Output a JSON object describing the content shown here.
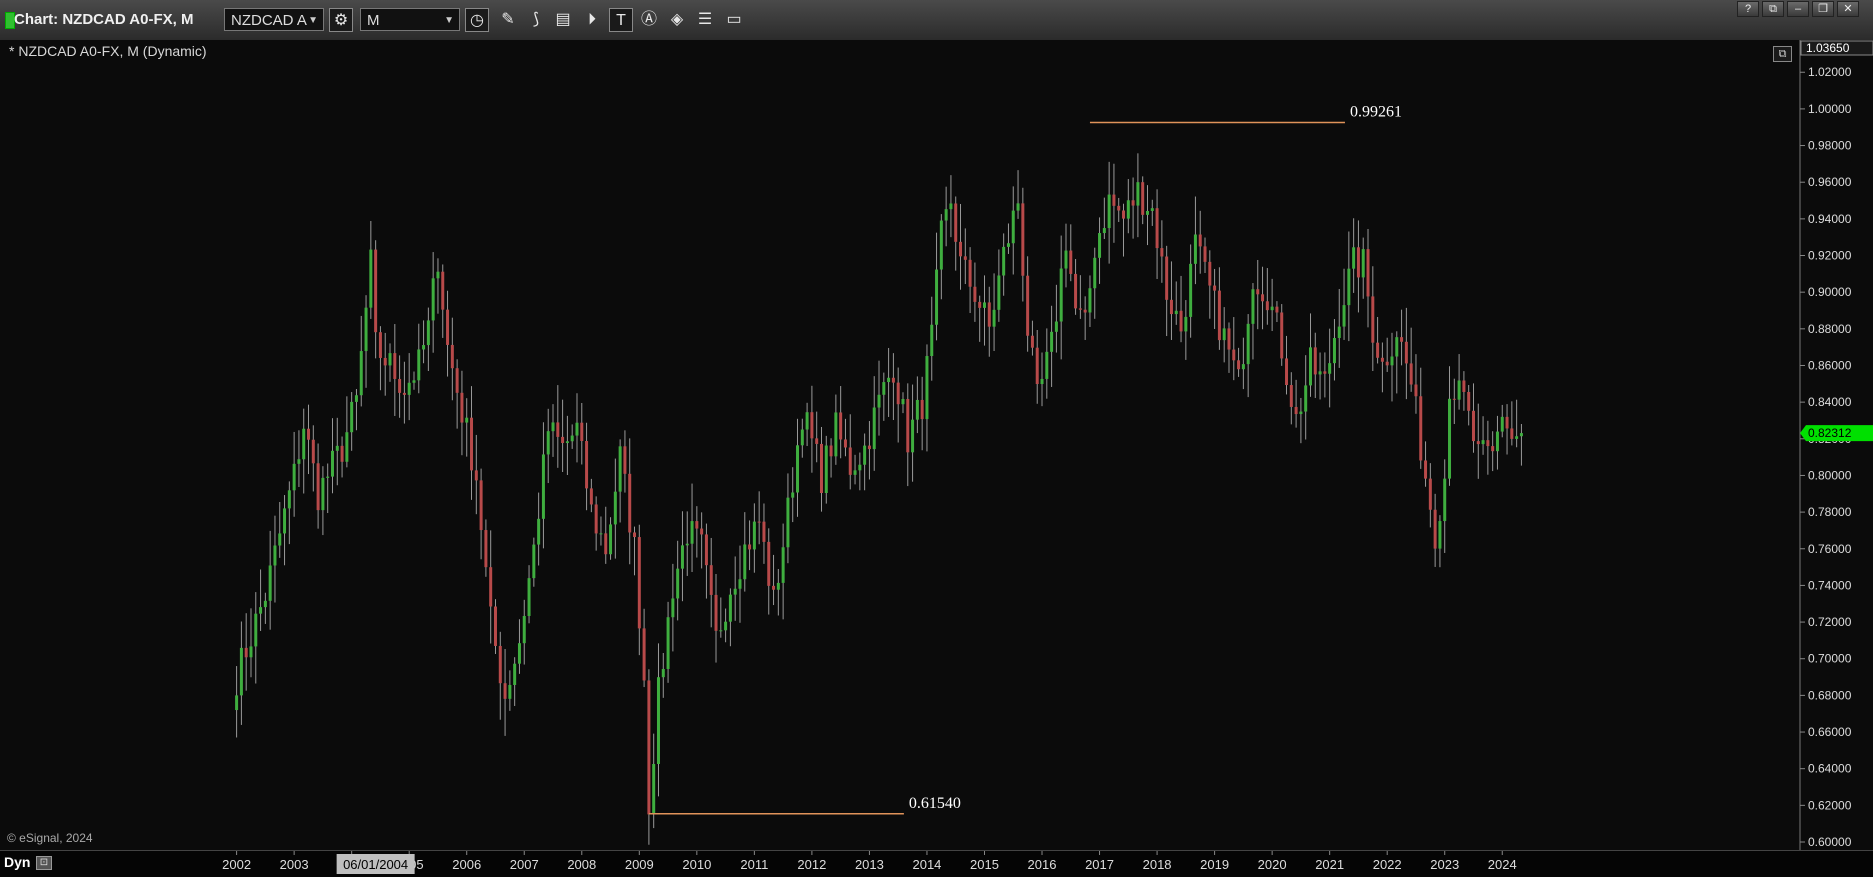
{
  "window": {
    "title": "Chart: NZDCAD A0-FX, M",
    "symbol_combo": "NZDCAD A",
    "interval_combo": "M",
    "winbuttons": [
      "?",
      "⧉",
      "–",
      "❐",
      "✕"
    ]
  },
  "toolbar_icons": [
    "settings-gear-icon",
    "clock-icon",
    "pencil-draw-icon",
    "line-study-icon",
    "bar-chart-icon",
    "play-icon",
    "text-tool-icon",
    "alert-icon",
    "eraser-icon",
    "drawing-menu-icon",
    "comment-icon"
  ],
  "chart_label": "* NZDCAD A0-FX, M (Dynamic)",
  "copyright": "© eSignal, 2024",
  "status": {
    "dyn_label": "Dyn",
    "cursor_date": "06/01/2004"
  },
  "colors": {
    "up": "#3fae3f",
    "down": "#b84a4a",
    "wick": "#9a9a9a",
    "annotation": "#e0935a",
    "last_price_bg": "#00e000"
  },
  "chart_data": {
    "type": "candlestick",
    "title": "",
    "xlabel": "",
    "ylabel": "",
    "ylim": [
      0.6,
      1.0365
    ],
    "y_ticks": [
      "0.60000",
      "0.62000",
      "0.64000",
      "0.66000",
      "0.68000",
      "0.70000",
      "0.72000",
      "0.74000",
      "0.76000",
      "0.78000",
      "0.80000",
      "0.82000",
      "0.84000",
      "0.86000",
      "0.88000",
      "0.90000",
      "0.92000",
      "0.94000",
      "0.96000",
      "0.98000",
      "1.00000",
      "1.02000"
    ],
    "y_top_label": "1.03650",
    "x_ticks": [
      "2002",
      "2003",
      "2004",
      "2005",
      "2006",
      "2007",
      "2008",
      "2009",
      "2010",
      "2011",
      "2012",
      "2013",
      "2014",
      "2015",
      "2016",
      "2017",
      "2018",
      "2019",
      "2020",
      "2021",
      "2022",
      "2023",
      "2024"
    ],
    "last_price": 0.82312,
    "last_price_label": "0.82312",
    "annotations": [
      {
        "label": "0.99261",
        "value": 0.99261,
        "date": "2016-11"
      },
      {
        "label": "0.61540",
        "value": 0.6154,
        "date": "2009-03"
      }
    ],
    "start": "2002-01",
    "end": "2024-05",
    "anchors": [
      [
        "2002-01",
        0.69
      ],
      [
        "2002-07",
        0.735
      ],
      [
        "2003-01",
        0.8
      ],
      [
        "2003-03",
        0.828
      ],
      [
        "2003-06",
        0.79
      ],
      [
        "2003-11",
        0.815
      ],
      [
        "2004-02",
        0.84
      ],
      [
        "2004-05",
        0.915
      ],
      [
        "2004-06",
        0.87
      ],
      [
        "2004-09",
        0.86
      ],
      [
        "2004-12",
        0.848
      ],
      [
        "2005-03",
        0.86
      ],
      [
        "2005-05",
        0.88
      ],
      [
        "2005-07",
        0.92
      ],
      [
        "2005-09",
        0.87
      ],
      [
        "2005-12",
        0.835
      ],
      [
        "2006-03",
        0.8
      ],
      [
        "2006-06",
        0.72
      ],
      [
        "2006-09",
        0.68
      ],
      [
        "2006-12",
        0.71
      ],
      [
        "2007-03",
        0.76
      ],
      [
        "2007-06",
        0.825
      ],
      [
        "2007-09",
        0.815
      ],
      [
        "2007-12",
        0.825
      ],
      [
        "2008-03",
        0.78
      ],
      [
        "2008-06",
        0.76
      ],
      [
        "2008-09",
        0.81
      ],
      [
        "2008-12",
        0.76
      ],
      [
        "2009-02",
        0.69
      ],
      [
        "2009-03",
        0.622
      ],
      [
        "2009-05",
        0.68
      ],
      [
        "2009-08",
        0.74
      ],
      [
        "2009-11",
        0.77
      ],
      [
        "2010-02",
        0.76
      ],
      [
        "2010-05",
        0.71
      ],
      [
        "2010-08",
        0.74
      ],
      [
        "2010-11",
        0.76
      ],
      [
        "2011-02",
        0.775
      ],
      [
        "2011-05",
        0.73
      ],
      [
        "2011-08",
        0.78
      ],
      [
        "2011-11",
        0.835
      ],
      [
        "2012-03",
        0.8
      ],
      [
        "2012-06",
        0.825
      ],
      [
        "2012-09",
        0.805
      ],
      [
        "2012-12",
        0.815
      ],
      [
        "2013-03",
        0.84
      ],
      [
        "2013-06",
        0.86
      ],
      [
        "2013-09",
        0.82
      ],
      [
        "2013-12",
        0.84
      ],
      [
        "2014-02",
        0.875
      ],
      [
        "2014-04",
        0.93
      ],
      [
        "2014-06",
        0.95
      ],
      [
        "2014-08",
        0.915
      ],
      [
        "2014-11",
        0.9
      ],
      [
        "2015-02",
        0.88
      ],
      [
        "2015-05",
        0.92
      ],
      [
        "2015-08",
        0.95
      ],
      [
        "2015-10",
        0.88
      ],
      [
        "2015-12",
        0.84
      ],
      [
        "2016-03",
        0.87
      ],
      [
        "2016-06",
        0.93
      ],
      [
        "2016-08",
        0.89
      ],
      [
        "2016-10",
        0.88
      ],
      [
        "2016-12",
        0.925
      ],
      [
        "2017-03",
        0.95
      ],
      [
        "2017-06",
        0.94
      ],
      [
        "2017-09",
        0.955
      ],
      [
        "2017-12",
        0.945
      ],
      [
        "2018-03",
        0.9
      ],
      [
        "2018-06",
        0.88
      ],
      [
        "2018-09",
        0.925
      ],
      [
        "2018-12",
        0.9
      ],
      [
        "2019-03",
        0.875
      ],
      [
        "2019-06",
        0.85
      ],
      [
        "2019-09",
        0.91
      ],
      [
        "2019-12",
        0.9
      ],
      [
        "2020-03",
        0.87
      ],
      [
        "2020-06",
        0.83
      ],
      [
        "2020-09",
        0.86
      ],
      [
        "2020-12",
        0.85
      ],
      [
        "2021-03",
        0.89
      ],
      [
        "2021-06",
        0.915
      ],
      [
        "2021-08",
        0.915
      ],
      [
        "2021-10",
        0.88
      ],
      [
        "2021-12",
        0.86
      ],
      [
        "2022-03",
        0.88
      ],
      [
        "2022-06",
        0.85
      ],
      [
        "2022-09",
        0.8
      ],
      [
        "2022-11",
        0.77
      ],
      [
        "2023-01",
        0.8
      ],
      [
        "2023-02",
        0.85
      ],
      [
        "2023-05",
        0.84
      ],
      [
        "2023-08",
        0.81
      ],
      [
        "2023-11",
        0.81
      ],
      [
        "2024-01",
        0.835
      ],
      [
        "2024-03",
        0.82
      ],
      [
        "2024-05",
        0.823
      ]
    ]
  }
}
